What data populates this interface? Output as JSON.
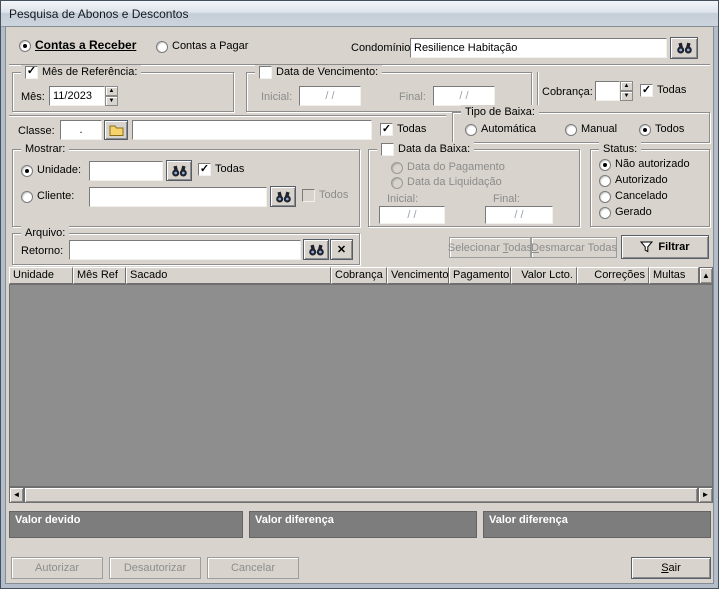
{
  "window": {
    "title": "Pesquisa de Abonos e Descontos"
  },
  "account_type": {
    "receber": "Contas a Receber",
    "pagar": "Contas a Pagar"
  },
  "condominio": {
    "label": "Condomínio:",
    "value": "Resilience Habitação"
  },
  "mes_referencia": {
    "title": "Mês de Referência:",
    "mes_label": "Mês:",
    "mes_value": "11/2023"
  },
  "data_vencimento": {
    "title": "Data de Vencimento:",
    "inicial_label": "Inicial:",
    "inicial_value": "/ /",
    "final_label": "Final:",
    "final_value": "/ /"
  },
  "cobranca": {
    "label": "Cobrança:",
    "value": "",
    "todas_label": "Todas"
  },
  "classe": {
    "label": "Classe:",
    "code": ".",
    "nome": "",
    "todas_label": "Todas"
  },
  "tipo_baixa": {
    "title": "Tipo de Baixa:",
    "automatica": "Automática",
    "manual": "Manual",
    "todos": "Todos"
  },
  "mostrar": {
    "title": "Mostrar:",
    "unidade_label": "Unidade:",
    "unidade_value": "",
    "unidade_todas": "Todas",
    "cliente_label": "Cliente:",
    "cliente_value": "",
    "cliente_todos": "Todos"
  },
  "data_baixa": {
    "title": "Data da Baixa:",
    "pagamento": "Data do Pagamento",
    "liquidacao": "Data da Liquidação",
    "inicial_label": "Inicial:",
    "inicial_value": "/ /",
    "final_label": "Final:",
    "final_value": "/ /"
  },
  "status": {
    "title": "Status:",
    "options": [
      "Não autorizado",
      "Autorizado",
      "Cancelado",
      "Gerado"
    ]
  },
  "arquivo": {
    "title": "Arquivo:",
    "retorno_label": "Retorno:",
    "retorno_value": ""
  },
  "actions": {
    "selecionar": "Selecionar &Todas",
    "desmarcar": "&Desmarcar Todas",
    "filtrar": "Filtrar"
  },
  "table": {
    "columns": [
      "Unidade",
      "Mês Ref",
      "Sacado",
      "Cobrança",
      "Vencimento",
      "Pagamento",
      "Valor Lcto.",
      "Correções",
      "Multas"
    ]
  },
  "totals": [
    "Valor devido",
    "Valor diferença",
    "Valor diferença"
  ],
  "footer": {
    "autorizar": "Autorizar",
    "desautorizar": "Desautorizar",
    "cancelar": "Cancelar",
    "sair": "&Sair"
  },
  "colors": {
    "dialog_bg": "#d8d4cd",
    "grid_bg": "#8e8e8e",
    "totals_bg": "#7d7d7d",
    "folder_icon": "#f6d26a"
  },
  "glyphs": {
    "check": "✓",
    "up": "▲",
    "down": "▼",
    "left": "◄",
    "right": "►",
    "clear": "✕"
  }
}
